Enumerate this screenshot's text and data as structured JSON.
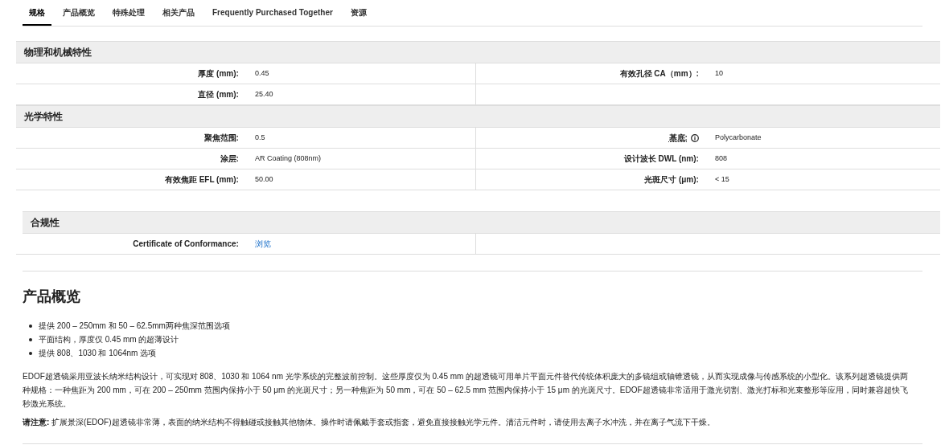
{
  "tabs": [
    {
      "label": "规格",
      "selected": true
    },
    {
      "label": "产品概览",
      "selected": false
    },
    {
      "label": "特殊处理",
      "selected": false
    },
    {
      "label": "相关产品",
      "selected": false
    },
    {
      "label": "Frequently Purchased Together",
      "selected": false
    },
    {
      "label": "资源",
      "selected": false
    }
  ],
  "sections": [
    {
      "title": "物理和机械特性",
      "indented": false,
      "rows": [
        [
          {
            "label": "厚度 (mm):",
            "value": "0.45",
            "kind": "text"
          },
          {
            "label": "有效孔径 CA（mm）:",
            "value": "10",
            "kind": "text"
          }
        ],
        [
          {
            "label": "直径 (mm):",
            "value": "25.40",
            "kind": "text"
          }
        ]
      ]
    },
    {
      "title": "光学特性",
      "indented": false,
      "rows": [
        [
          {
            "label": "聚焦范围:",
            "value": "0.5",
            "kind": "text"
          },
          {
            "label": "基底:",
            "value": "Polycarbonate",
            "kind": "text",
            "info": true
          }
        ],
        [
          {
            "label": "涂层:",
            "value": "AR Coating (808nm)",
            "kind": "text"
          },
          {
            "label": "设计波长 DWL (nm):",
            "value": "808",
            "kind": "text"
          }
        ],
        [
          {
            "label": "有效焦距 EFL (mm):",
            "value": "50.00",
            "kind": "text"
          },
          {
            "label": "光斑尺寸 (μm):",
            "value": "< 15",
            "kind": "text"
          }
        ]
      ]
    },
    {
      "title": "合规性",
      "indented": true,
      "rows": [
        [
          {
            "label": "Certificate of Conformance:",
            "value": "浏览",
            "kind": "link"
          }
        ]
      ]
    }
  ],
  "overview": {
    "title": "产品概览",
    "bullets": [
      "提供 200 – 250mm 和 50 – 62.5mm两种焦深范围选项",
      "平面结构，厚度仅 0.45 mm 的超薄设计",
      "提供  808、1030 和 1064nm 选项"
    ],
    "paragraphs": [
      "EDOF超透镜采用亚波长纳米结构设计，可实现对 808、1030 和 1064 nm 光学系统的完整波前控制。这些厚度仅为 0.45 mm 的超透镜可用单片平面元件替代传统体积庞大的多镜组或轴锥透镜，从而实现成像与传感系统的小型化。该系列超透镜提供两种规格：一种焦距为 200 mm，可在 200 – 250mm 范围内保持小于 50 μm 的光斑尺寸；另一种焦距为 50 mm，可在  50 – 62.5 mm 范围内保持小于 15 μm 的光斑尺寸。EDOF超透镜非常适用于激光切割、激光打标和光束整形等应用，同时兼容超快飞秒激光系统。",
      "**请注意:** 扩展景深(EDOF)超透镜非常薄，表面的纳米结构不得触碰或接触其他物体。操作时请佩戴手套或指套，避免直接接触光学元件。清洁元件时，请使用去离子水冲洗，并在离子气流下干燥。"
    ]
  }
}
